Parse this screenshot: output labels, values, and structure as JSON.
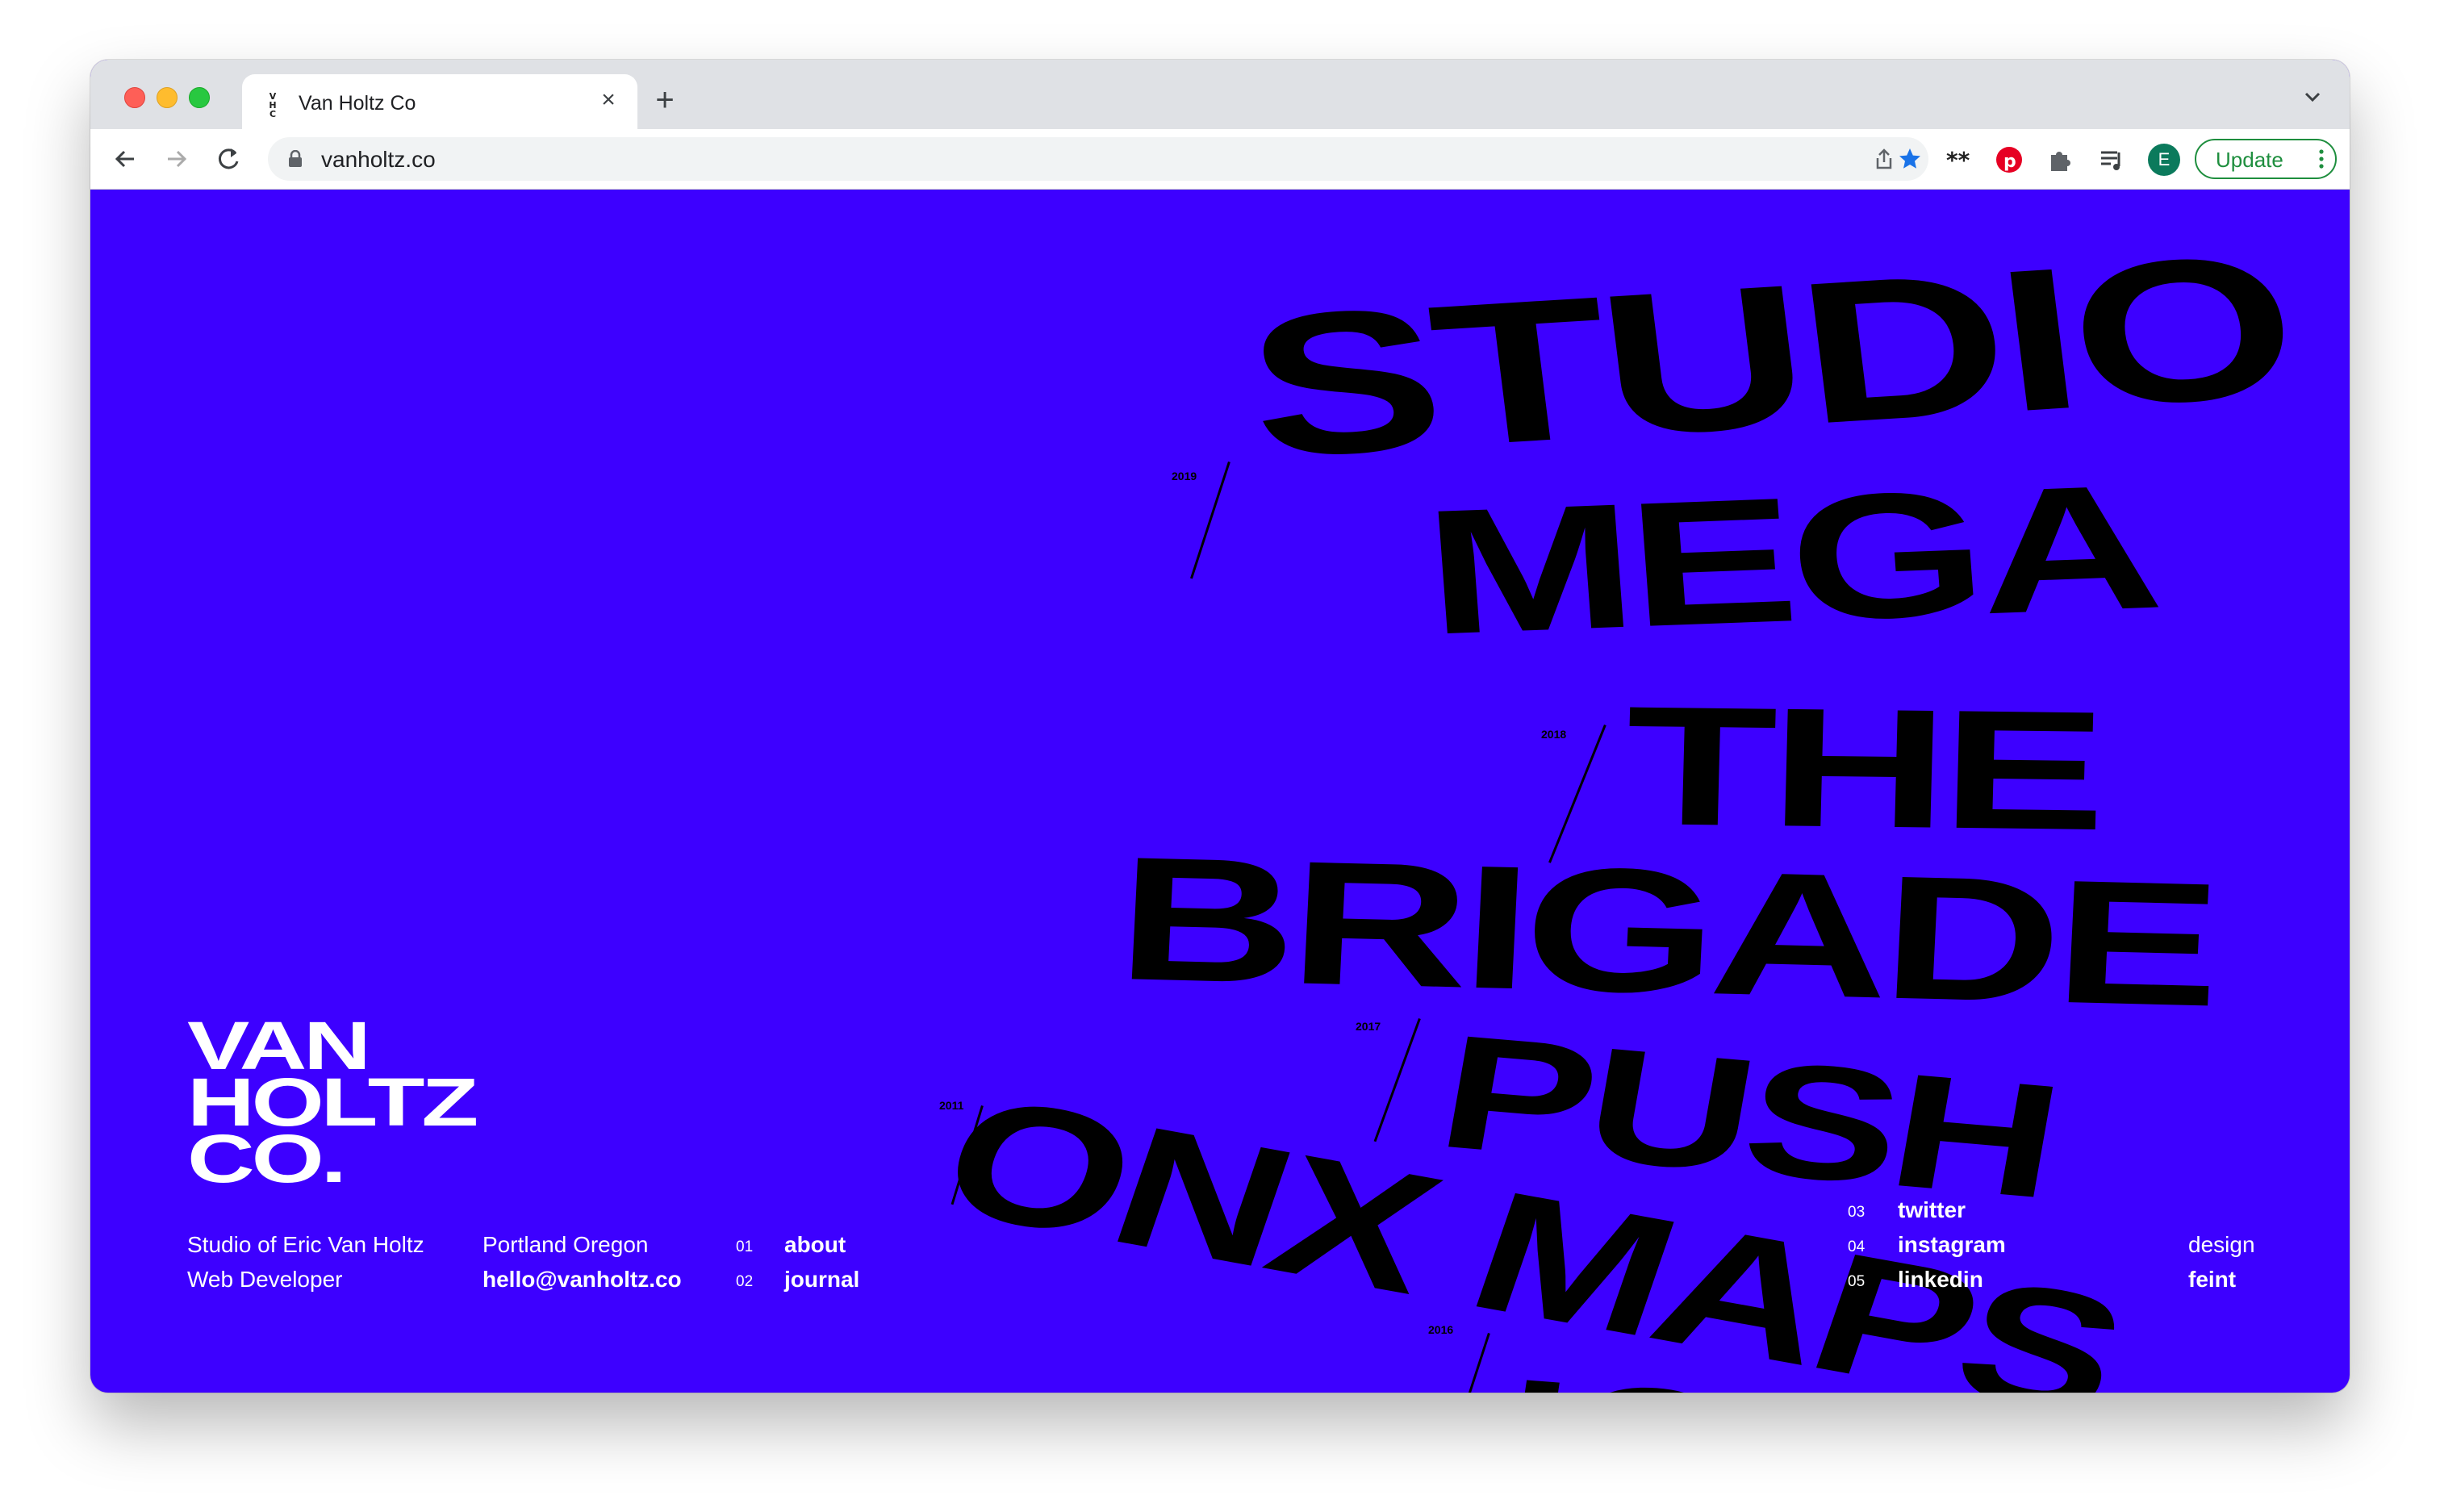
{
  "browser": {
    "tab_title": "Van Holtz Co",
    "favicon_text": "V H C",
    "url": "vanholtz.co",
    "profile_initial": "E",
    "update_label": "Update"
  },
  "hero": {
    "projects": [
      {
        "name": "STUDIO",
        "year": "2019"
      },
      {
        "name": "MEGA",
        "year": ""
      },
      {
        "name": "THE",
        "year": "2018"
      },
      {
        "name": "BRIGADE",
        "year": ""
      },
      {
        "name": "PUSH",
        "year": "2017"
      },
      {
        "name": "ONX MAPS",
        "year": "2011"
      },
      {
        "name": "IO",
        "year": "2016"
      }
    ]
  },
  "logo": {
    "line1": "VAN",
    "line2": "HOLTZ",
    "line3": "CO."
  },
  "footer": {
    "studio": "Studio of Eric Van Holtz",
    "role": "Web Developer",
    "location": "Portland Oregon",
    "email": "hello@vanholtz.co",
    "nav": [
      {
        "num": "01",
        "label": "about"
      },
      {
        "num": "02",
        "label": "journal"
      }
    ],
    "social": [
      {
        "num": "03",
        "label": "twitter"
      },
      {
        "num": "04",
        "label": "instagram"
      },
      {
        "num": "05",
        "label": "linkedin"
      }
    ],
    "credit_label": "design",
    "credit_name": "feint"
  },
  "colors": {
    "page_bg": "#3d00ff",
    "text_light": "#ffffff",
    "display_text": "#000000",
    "update_green": "#1e8e3e",
    "bookmark_blue": "#1a73e8",
    "pinterest_red": "#e60023"
  }
}
